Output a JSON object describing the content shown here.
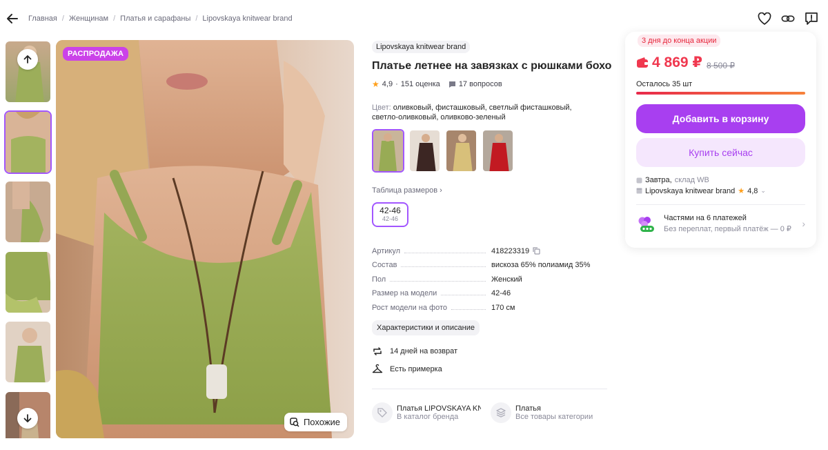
{
  "breadcrumbs": [
    "Главная",
    "Женщинам",
    "Платья и сарафаны",
    "Lipovskaya knitwear brand"
  ],
  "gallery": {
    "sale_badge": "РАСПРОДАЖА",
    "similar_label": "Похожие"
  },
  "product": {
    "brand": "Lipovskaya knitwear brand",
    "title": "Платье летнее на завязках с рюшками бохо",
    "rating": "4,9",
    "reviews": "151 оценка",
    "questions": "17 вопросов",
    "color_label": "Цвет:",
    "color_value": "оливковый, фисташковый, светлый фисташковый, светло-оливковый, оливково-зеленый",
    "size_table_label": "Таблица размеров",
    "size": {
      "main": "42-46",
      "sub": "42-46"
    },
    "specs": [
      {
        "k": "Артикул",
        "v": "418223319"
      },
      {
        "k": "Состав",
        "v": "вискоза 65% полиамид 35%"
      },
      {
        "k": "Пол",
        "v": "Женский"
      },
      {
        "k": "Размер на модели",
        "v": "42-46"
      },
      {
        "k": "Рост модели на фото",
        "v": "170 см"
      }
    ],
    "char_button": "Характеристики и описание",
    "features": {
      "return": "14 дней на возврат",
      "fitting": "Есть примерка"
    },
    "links": [
      {
        "t1": "Платья LIPOVSKAYA KNITWEAR BRAND",
        "t2": "В каталог бренда"
      },
      {
        "t1": "Платья",
        "t2": "Все товары категории"
      }
    ]
  },
  "buy": {
    "promo": "3 дня до конца акции",
    "price": "4 869 ₽",
    "old_price": "8 500 ₽",
    "stock": "Осталось 35 шт",
    "add_to_cart": "Добавить в корзину",
    "buy_now": "Купить сейчас",
    "delivery_day": "Завтра,",
    "delivery_from": "склад WB",
    "seller": "Lipovskaya knitwear brand",
    "seller_rating": "4,8",
    "split_title": "Частями на 6 платежей",
    "split_sub": "Без переплат, первый платёж — 0 ₽"
  },
  "colors": {
    "accent": "#a83ff0",
    "price": "#f0384f",
    "badge": "#cb42e8",
    "active_border": "#a256ff"
  }
}
